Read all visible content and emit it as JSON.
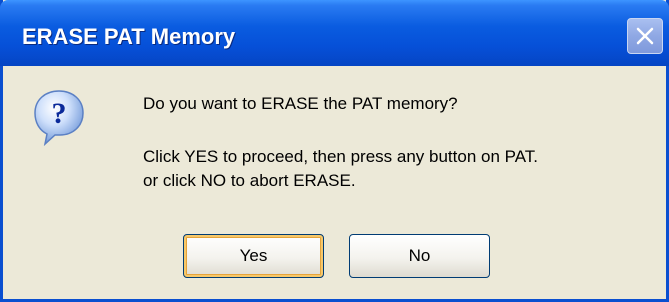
{
  "dialog": {
    "title": "ERASE PAT Memory",
    "message_line1": "Do you want to ERASE the PAT memory?",
    "message_line2": "Click YES to proceed, then press any button on PAT.",
    "message_line3": "or click NO to abort ERASE.",
    "icon": "question-icon",
    "close_icon": "close-icon",
    "buttons": {
      "yes_label": "Yes",
      "no_label": "No"
    }
  }
}
